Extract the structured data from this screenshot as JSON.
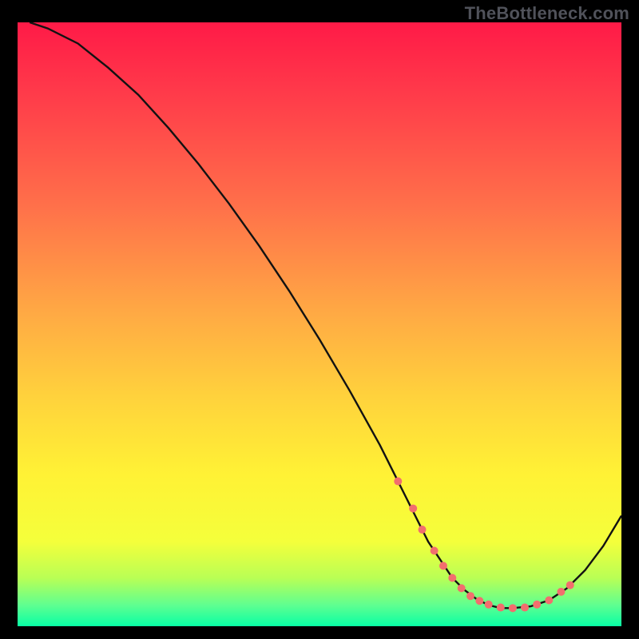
{
  "watermark": "TheBottleneck.com",
  "colors": {
    "frame": "#000000",
    "curve_stroke": "#121212",
    "marker_fill": "#f26e6e",
    "gradient_stops": [
      {
        "offset": 0.0,
        "color": "#ff1a47"
      },
      {
        "offset": 0.12,
        "color": "#ff3b4a"
      },
      {
        "offset": 0.3,
        "color": "#ff6f4a"
      },
      {
        "offset": 0.48,
        "color": "#ffa944"
      },
      {
        "offset": 0.62,
        "color": "#ffd23c"
      },
      {
        "offset": 0.75,
        "color": "#fff235"
      },
      {
        "offset": 0.86,
        "color": "#f4ff3b"
      },
      {
        "offset": 0.92,
        "color": "#b9ff55"
      },
      {
        "offset": 0.965,
        "color": "#5fff90"
      },
      {
        "offset": 1.0,
        "color": "#08ffa5"
      }
    ]
  },
  "chart_data": {
    "type": "line",
    "title": "",
    "xlabel": "",
    "ylabel": "",
    "xlim": [
      0,
      100
    ],
    "ylim": [
      0,
      100
    ],
    "x": [
      2,
      5,
      10,
      15,
      20,
      25,
      30,
      35,
      40,
      45,
      50,
      55,
      60,
      63,
      65,
      68,
      70,
      72,
      74,
      76,
      78,
      80,
      82,
      85,
      88,
      91,
      94,
      97,
      100
    ],
    "values": [
      100,
      99,
      96.5,
      92.5,
      88,
      82.5,
      76.5,
      70,
      63,
      55.5,
      47.5,
      39,
      30,
      24,
      20,
      14,
      11,
      8,
      6,
      4.5,
      3.5,
      3,
      3,
      3.3,
      4.3,
      6.3,
      9.3,
      13.3,
      18.3
    ],
    "markers": {
      "x": [
        63,
        65.5,
        67,
        69,
        70.5,
        72,
        73.5,
        75,
        76.5,
        78,
        80,
        82,
        84,
        86,
        88,
        90,
        91.5
      ],
      "values": [
        24,
        19.5,
        16,
        12.5,
        10,
        8,
        6.3,
        5,
        4.2,
        3.6,
        3.1,
        3,
        3.1,
        3.6,
        4.3,
        5.7,
        6.8
      ]
    }
  }
}
